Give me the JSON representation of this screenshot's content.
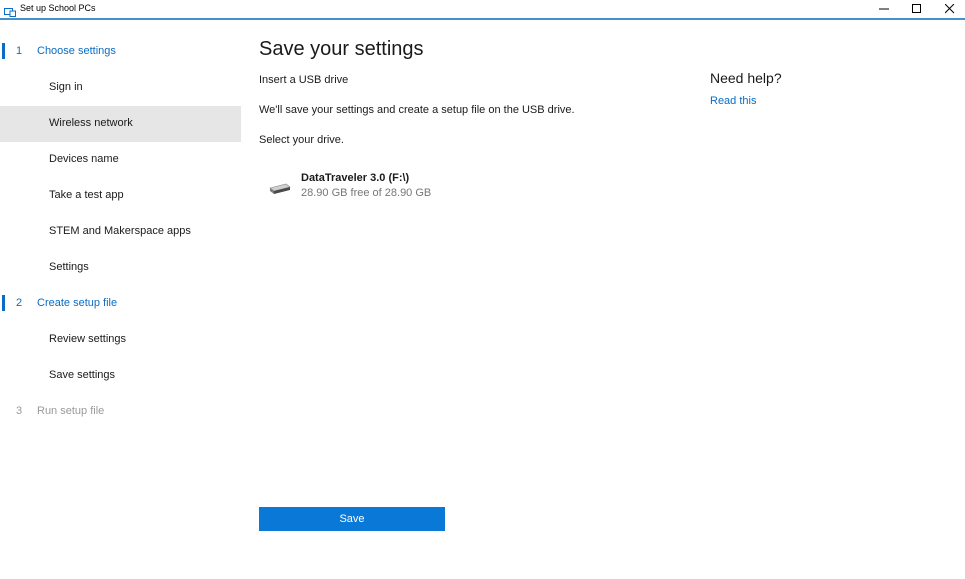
{
  "window": {
    "title": "Set up School PCs",
    "app_icon": "school-pc-icon",
    "controls": [
      "minimize-icon",
      "maximize-icon",
      "close-icon"
    ]
  },
  "sidebar": {
    "step1": {
      "number": "1",
      "label": "Choose settings",
      "state": "active"
    },
    "step1_items": [
      {
        "label": "Sign in"
      },
      {
        "label": "Wireless network",
        "selected": true
      },
      {
        "label": "Devices name"
      },
      {
        "label": "Take a test app"
      },
      {
        "label": "STEM and Makerspace apps"
      },
      {
        "label": "Settings"
      }
    ],
    "step2": {
      "number": "2",
      "label": "Create setup file",
      "state": "active"
    },
    "step2_items": [
      {
        "label": "Review settings"
      },
      {
        "label": "Save settings"
      }
    ],
    "step3": {
      "number": "3",
      "label": "Run setup file",
      "state": "disabled"
    }
  },
  "main": {
    "title": "Save your settings",
    "instruction": "Insert a USB drive",
    "description": "We'll save your settings and create a setup file on the USB drive.",
    "select_prompt": "Select your drive.",
    "drive": {
      "icon": "usb-drive-icon",
      "name": "DataTraveler 3.0 (F:\\)",
      "free_space": "28.90 GB free of 28.90 GB"
    },
    "save_label": "Save"
  },
  "help": {
    "title": "Need help?",
    "link": "Read this"
  },
  "colors": {
    "accent": "#0a6cc4",
    "button": "#0a78d7",
    "selected_bg": "#e6e6e6",
    "disabled_text": "#9a9a9a"
  }
}
